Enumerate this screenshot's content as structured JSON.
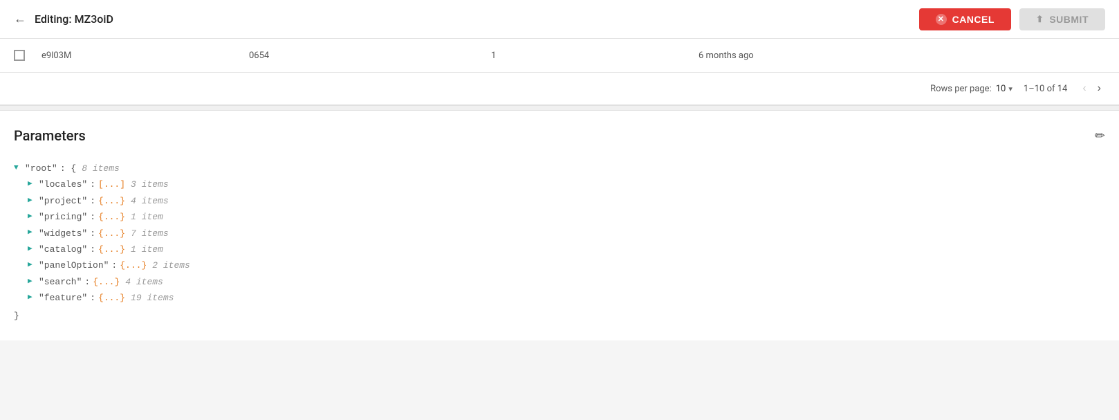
{
  "header": {
    "back_arrow": "←",
    "title": "Editing: MZ3oiD",
    "cancel_label": "CANCEL",
    "submit_label": "SUBMIT"
  },
  "table": {
    "row": {
      "id": "e9l03M",
      "code": "0654",
      "num": "1",
      "time": "6 months ago"
    }
  },
  "pagination": {
    "rows_per_page_label": "Rows per page:",
    "rows_per_page_value": "10",
    "page_info": "1–10 of 14"
  },
  "parameters": {
    "title": "Parameters",
    "tree": {
      "root_key": "\"root\"",
      "root_open": "{",
      "root_count": "8 items",
      "items": [
        {
          "key": "\"locales\"",
          "type": "[...]",
          "count": "3 items"
        },
        {
          "key": "\"project\"",
          "type": "{...}",
          "count": "4 items"
        },
        {
          "key": "\"pricing\"",
          "type": "{...}",
          "count": "1 item"
        },
        {
          "key": "\"widgets\"",
          "type": "{...}",
          "count": "7 items"
        },
        {
          "key": "\"catalog\"",
          "type": "{...}",
          "count": "1 item"
        },
        {
          "key": "\"panelOption\"",
          "type": "{...}",
          "count": "2 items"
        },
        {
          "key": "\"search\"",
          "type": "{...}",
          "count": "4 items"
        },
        {
          "key": "\"feature\"",
          "type": "{...}",
          "count": "19 items"
        }
      ]
    }
  }
}
